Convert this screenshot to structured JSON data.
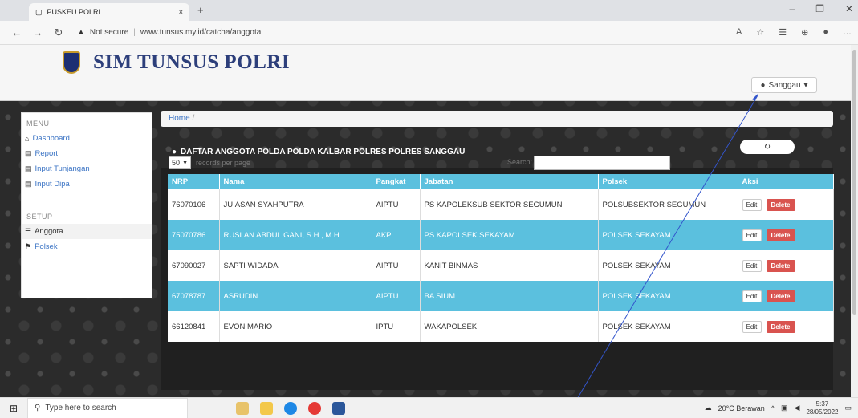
{
  "browser": {
    "tab_title": "PUSKEU POLRI",
    "tab_close": "×",
    "new_tab": "+",
    "security": "Not secure",
    "url": "www.tunsus.my.id/catcha/anggota",
    "minimize": "–",
    "restore": "❐",
    "close": "✕"
  },
  "header": {
    "brand": "SIM TUNSUS POLRI",
    "user": "Sanggau"
  },
  "sidebar": {
    "menu_heading": "MENU",
    "menu_items": [
      "Dashboard",
      "Report",
      "Input Tunjangan",
      "Input Dipa"
    ],
    "setup_heading": "SETUP",
    "setup_items": [
      "Anggota",
      "Polsek"
    ]
  },
  "main": {
    "breadcrumb": "Home",
    "breadcrumb_sep": "/",
    "panel_title": "DAFTAR ANGGOTA POLDA POLDA KALBAR POLRES POLRES SANGGAU",
    "page_size": "50",
    "records_per_page": "records per page",
    "search_label": "Search:",
    "search_value": ""
  },
  "table": {
    "columns": [
      "NRP",
      "Nama",
      "Pangkat",
      "Jabatan",
      "Polsek",
      "Aksi"
    ],
    "rows": [
      {
        "nrp": "76070106",
        "nama": "JUIASAN SYAHPUTRA",
        "pangkat": "AIPTU",
        "jabatan": "PS KAPOLEKSUB SEKTOR SEGUMUN",
        "polsek": "POLSUBSEKTOR SEGUMUN"
      },
      {
        "nrp": "75070786",
        "nama": "RUSLAN ABDUL GANI, S.H., M.H.",
        "pangkat": "AKP",
        "jabatan": "PS KAPOLSEK SEKAYAM",
        "polsek": "POLSEK SEKAYAM"
      },
      {
        "nrp": "67090027",
        "nama": "SAPTI WIDADA",
        "pangkat": "AIPTU",
        "jabatan": "KANIT BINMAS",
        "polsek": "POLSEK SEKAYAM"
      },
      {
        "nrp": "67078787",
        "nama": "ASRUDIN",
        "pangkat": "AIPTU",
        "jabatan": "BA SIUM",
        "polsek": "POLSEK SEKAYAM"
      },
      {
        "nrp": "66120841",
        "nama": "EVON MARIO",
        "pangkat": "IPTU",
        "jabatan": "WAKAPOLSEK",
        "polsek": "POLSEK SEKAYAM"
      }
    ],
    "edit_label": "Edit",
    "delete_label": "Delete"
  },
  "taskbar": {
    "search_placeholder": "Type here to search",
    "weather": "20°C Berawan",
    "time": "5:37",
    "date": "28/05/2022"
  },
  "colors": {
    "table_header": "#5bc0de",
    "delete": "#d9534f",
    "brand": "#2d3f7b"
  }
}
